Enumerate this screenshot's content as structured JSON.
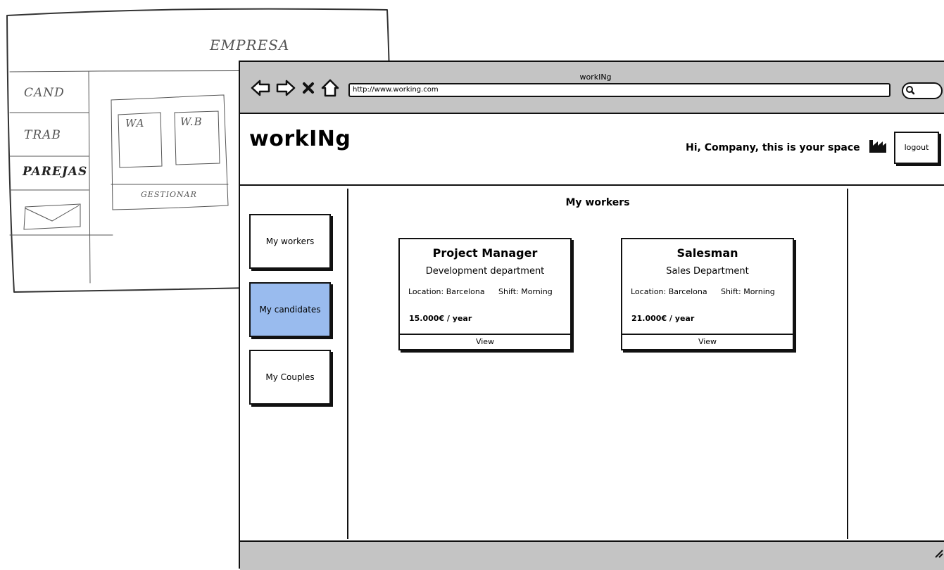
{
  "sketch": {
    "title": "EMPRESA",
    "items": [
      "CAND",
      "TRAB",
      "PAREJAS"
    ],
    "cards": [
      "WA",
      "W.B"
    ],
    "footer": "GESTIONAR"
  },
  "browser": {
    "window_title": "workINg",
    "url": "http://www.working.com"
  },
  "header": {
    "logo": "workINg",
    "greeting": "Hi, Company, this is your space",
    "logout_label": "logout"
  },
  "sidebar": {
    "items": [
      {
        "label": "My workers"
      },
      {
        "label": "My candidates"
      },
      {
        "label": "My Couples"
      }
    ]
  },
  "main": {
    "title": "My workers",
    "cards": [
      {
        "title": "Project Manager",
        "department": "Development department",
        "location": "Location: Barcelona",
        "shift": "Shift: Morning",
        "salary": "15.000€ / year",
        "view_label": "View"
      },
      {
        "title": "Salesman",
        "department": "Sales Department",
        "location": "Location: Barcelona",
        "shift": "Shift: Morning",
        "salary": "21.000€ / year",
        "view_label": "View"
      }
    ]
  },
  "colors": {
    "active": "#99bbee",
    "chrome": "#c4c4c4",
    "ink": "#111111"
  },
  "icons": {
    "back": "back-arrow-icon",
    "forward": "forward-arrow-icon",
    "stop": "close-icon",
    "home": "home-icon",
    "search": "search-icon",
    "company": "factory-icon",
    "resize": "resize-grip-icon"
  }
}
